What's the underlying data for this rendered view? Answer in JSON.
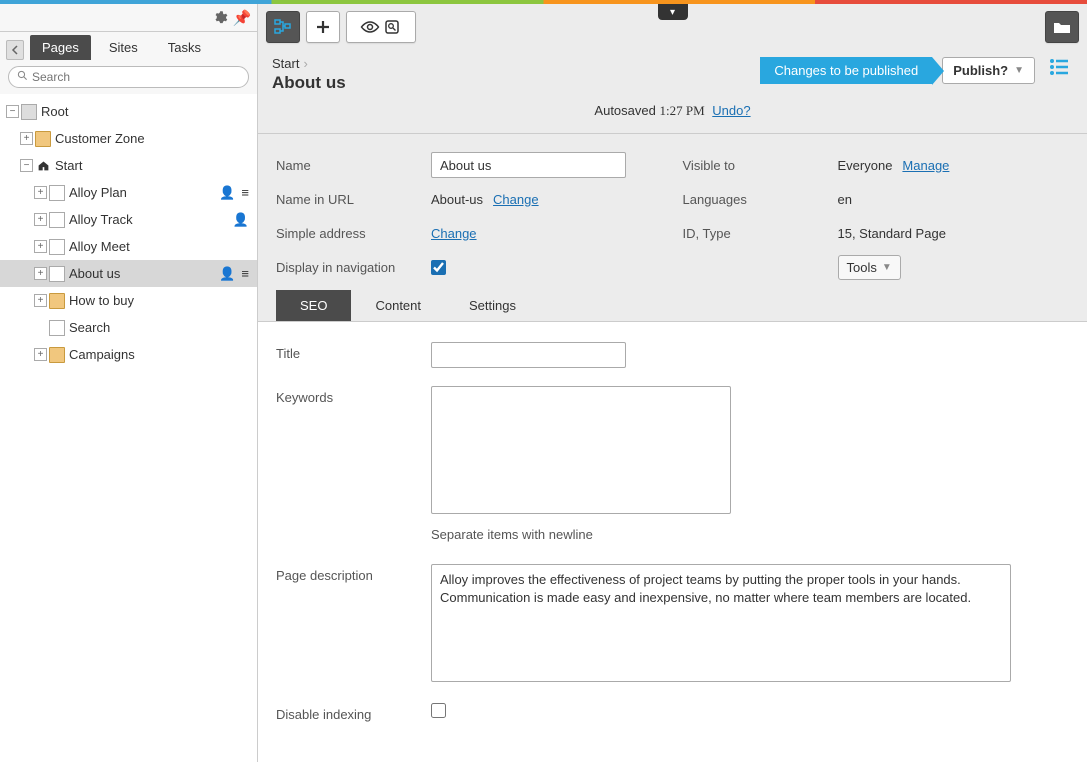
{
  "leftPanel": {
    "tabs": {
      "pages": "Pages",
      "sites": "Sites",
      "tasks": "Tasks"
    },
    "searchPlaceholder": "Search",
    "tree": {
      "root": "Root",
      "customerZone": "Customer Zone",
      "start": "Start",
      "alloyPlan": "Alloy Plan",
      "alloyTrack": "Alloy Track",
      "alloyMeet": "Alloy Meet",
      "aboutUs": "About us",
      "howToBuy": "How to buy",
      "search": "Search",
      "campaigns": "Campaigns"
    }
  },
  "header": {
    "breadcrumbParent": "Start",
    "title": "About us",
    "changesBadge": "Changes to be published",
    "publishLabel": "Publish?",
    "autosavePrefix": "Autosaved",
    "autosaveTime": "1:27 PM",
    "undo": "Undo?"
  },
  "props": {
    "nameLabel": "Name",
    "nameValue": "About us",
    "nameInUrlLabel": "Name in URL",
    "nameInUrlValue": "About-us",
    "changeLink": "Change",
    "simpleAddressLabel": "Simple address",
    "displayNavLabel": "Display in navigation",
    "visibleToLabel": "Visible to",
    "visibleToValue": "Everyone",
    "manageLink": "Manage",
    "languagesLabel": "Languages",
    "languagesValue": "en",
    "idTypeLabel": "ID, Type",
    "idTypeValue": "15, Standard Page",
    "toolsLabel": "Tools"
  },
  "tabs": {
    "seo": "SEO",
    "content": "Content",
    "settings": "Settings"
  },
  "seo": {
    "titleLabel": "Title",
    "titleValue": "",
    "keywordsLabel": "Keywords",
    "keywordsValue": "",
    "keywordsHint": "Separate items with newline",
    "pageDescLabel": "Page description",
    "pageDescValue": "Alloy improves the effectiveness of project teams by putting the proper tools in your hands. Communication is made easy and inexpensive, no matter where team members are located.",
    "disableIndexingLabel": "Disable indexing"
  }
}
